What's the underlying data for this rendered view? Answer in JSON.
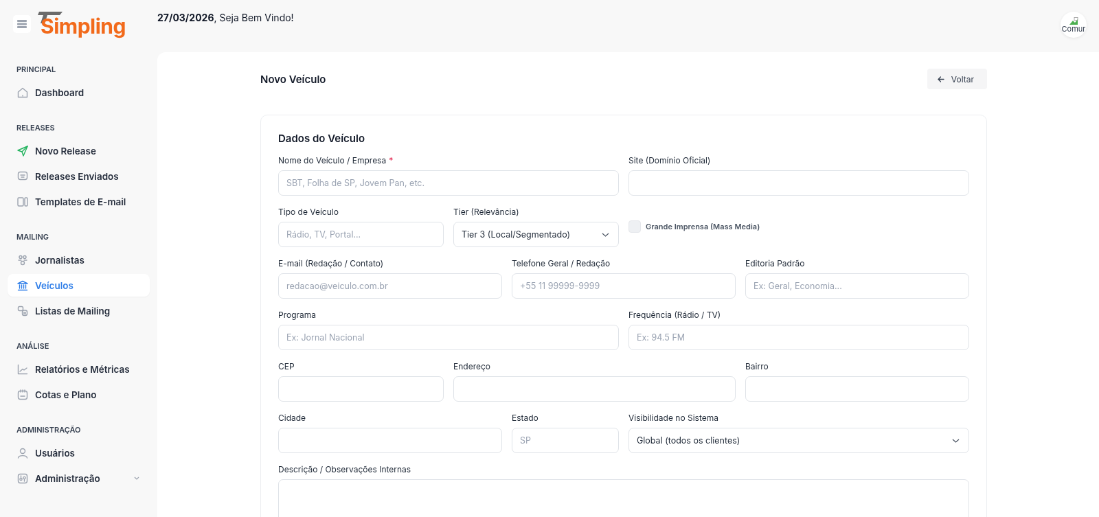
{
  "header": {
    "logo": "Simpling",
    "greeting": "**27/03/2026**, Seja Bem Vindo!",
    "avatar_alt": "Comur"
  },
  "sidebar": {
    "sections": [
      {
        "title": "PRINCIPAL",
        "items": [
          {
            "label": "Dashboard",
            "selected": false
          }
        ]
      },
      {
        "title": "RELEASES",
        "items": [
          {
            "label": "Novo Release",
            "selected": false
          },
          {
            "label": "Releases Enviados",
            "selected": false
          },
          {
            "label": "Templates de E-mail",
            "selected": false
          }
        ]
      },
      {
        "title": "MAILING",
        "items": [
          {
            "label": "Jornalistas",
            "selected": false
          },
          {
            "label": "Veículos",
            "selected": true
          },
          {
            "label": "Listas de Mailing",
            "selected": false
          }
        ]
      },
      {
        "title": "ANÁLISE",
        "items": [
          {
            "label": "Relatórios e Métricas",
            "selected": false
          },
          {
            "label": "Cotas e Plano",
            "selected": false
          }
        ]
      },
      {
        "title": "ADMINISTRAÇÃO",
        "items": [
          {
            "label": "Usuários",
            "selected": false
          },
          {
            "label": "Administração",
            "selected": false,
            "expanded": false
          }
        ]
      }
    ]
  },
  "page": {
    "title": "Novo Veículo",
    "back_button": "Voltar"
  },
  "form": {
    "title": "Dados do Veículo",
    "fields": [
      {
        "kind": "text",
        "label": "Nome do Veículo / Empresa",
        "required_mark": "*",
        "placeholder": "SBT, Folha de SP, Jovem Pan, etc."
      },
      {
        "kind": "text",
        "label": "Site (Domínio Oficial)"
      },
      {
        "kind": "text",
        "label": "Tipo de Veículo",
        "placeholder": "Rádio, TV, Portal..."
      },
      {
        "kind": "select",
        "label": "Tier (Relevância)",
        "value": "Tier 3 (Local/Segmentado)"
      },
      {
        "kind": "checkbox",
        "label": "Grande Imprensa (Mass Media)",
        "checked": false
      },
      {
        "kind": "text",
        "label": "E-mail (Redação / Contato)",
        "placeholder": "redacao@veiculo.com.br"
      },
      {
        "kind": "text",
        "label": "Telefone Geral / Redação",
        "placeholder": "+55 11 99999-9999"
      },
      {
        "kind": "text",
        "label": "Editoria Padrão",
        "placeholder": "Ex: Geral, Economia..."
      },
      {
        "kind": "text",
        "label": "Programa",
        "placeholder": "Ex: Jornal Nacional"
      },
      {
        "kind": "text",
        "label": "Frequência (Rádio / TV)",
        "placeholder": "Ex: 94.5 FM"
      },
      {
        "kind": "text",
        "label": "CEP"
      },
      {
        "kind": "text",
        "label": "Endereço"
      },
      {
        "kind": "text",
        "label": "Bairro"
      },
      {
        "kind": "text",
        "label": "Cidade"
      },
      {
        "kind": "text",
        "label": "Estado",
        "placeholder": "SP"
      },
      {
        "kind": "select",
        "label": "Visibilidade no Sistema",
        "value": "Global (todos os clientes)"
      },
      {
        "kind": "textarea",
        "label": "Descrição / Observações Internas"
      }
    ]
  }
}
